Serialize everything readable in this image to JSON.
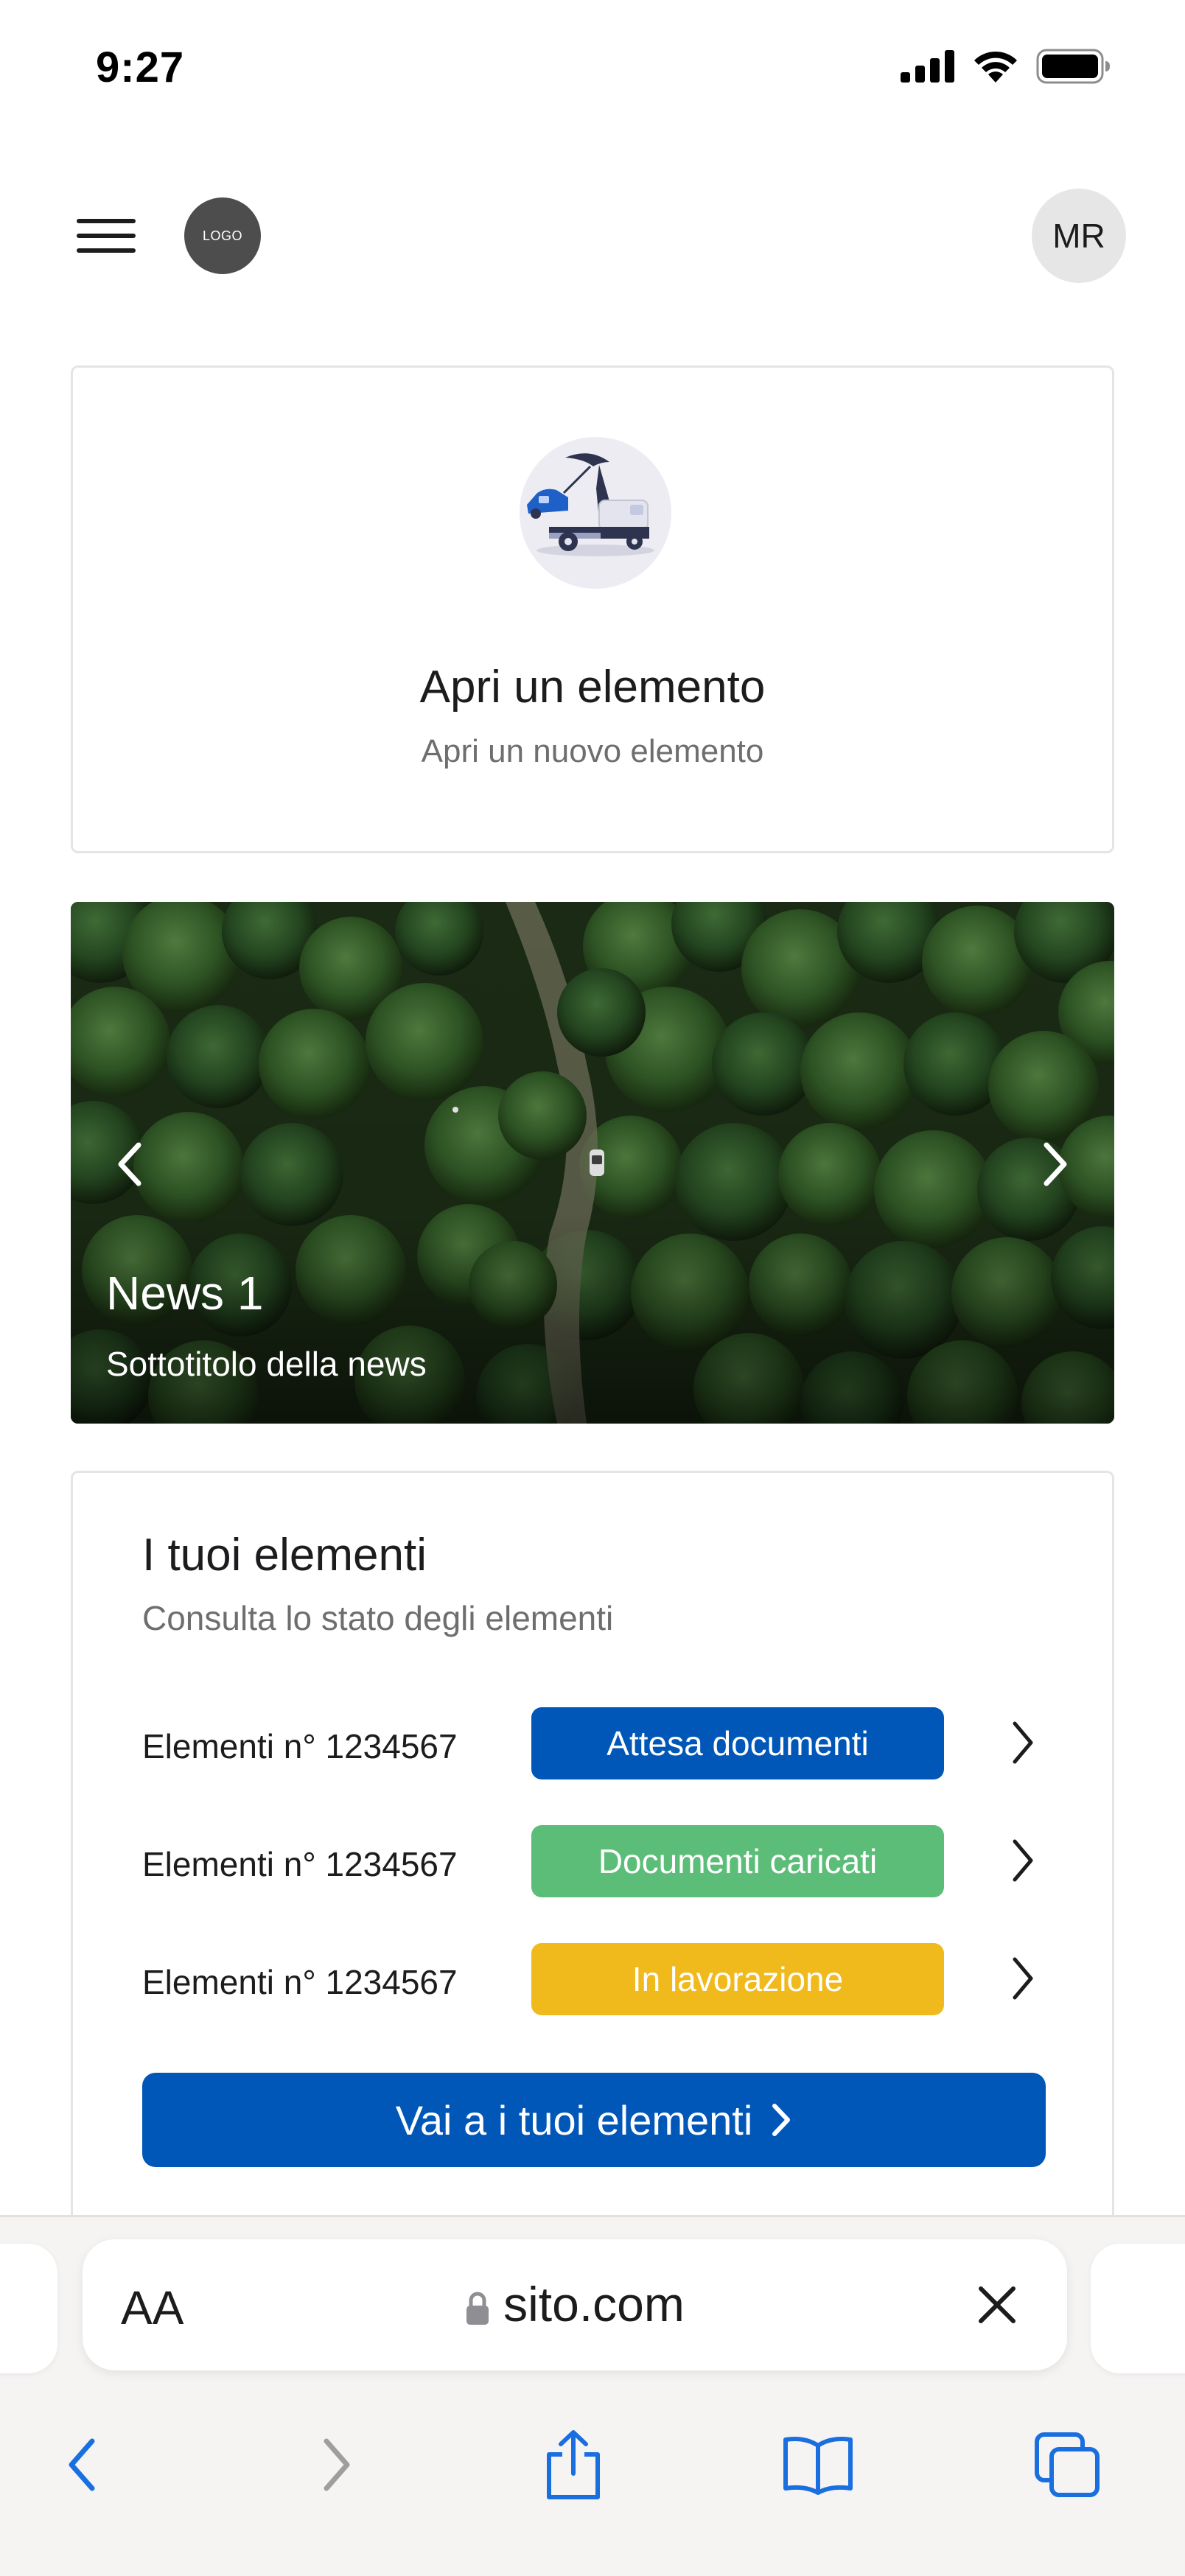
{
  "status_bar": {
    "time": "9:27"
  },
  "header": {
    "logo_text": "LOGO",
    "avatar_initials": "MR"
  },
  "open_card": {
    "title": "Apri un elemento",
    "subtitle": "Apri un nuovo elemento"
  },
  "news": {
    "title": "News 1",
    "subtitle": "Sottotitolo della news"
  },
  "elements": {
    "title": "I tuoi elementi",
    "subtitle": "Consulta lo stato degli elementi",
    "rows": [
      {
        "label": "Elementi n° 1234567",
        "status": "Attesa documenti",
        "color": "#0057b8"
      },
      {
        "label": "Elementi n° 1234567",
        "status": "Documenti caricati",
        "color": "#5cbd78"
      },
      {
        "label": "Elementi n° 1234567",
        "status": "In lavorazione",
        "color": "#f0b91c"
      }
    ],
    "cta_label": "Vai a i tuoi elementi"
  },
  "browser": {
    "text_size_label": "AA",
    "url": "sito.com"
  },
  "colors": {
    "primary": "#0057b8",
    "toolbar_accent": "#1a6fe0",
    "disabled": "#9e9e9e"
  },
  "icons": [
    "menu-icon",
    "chevron-left-icon",
    "chevron-right-icon",
    "lock-icon",
    "close-icon",
    "share-icon",
    "bookmarks-icon",
    "tabs-icon",
    "signal-icon",
    "wifi-icon",
    "battery-icon"
  ]
}
